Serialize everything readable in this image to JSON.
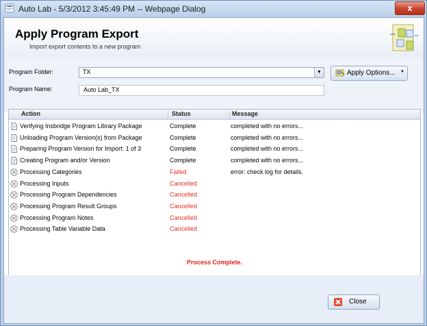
{
  "window": {
    "title": "Auto Lab - 5/3/2012 3:45:49 PM -- Webpage Dialog",
    "close_glyph": "x"
  },
  "header": {
    "title": "Apply Program Export",
    "subtitle": "Import export contents to a new program",
    "icon": "export-program-icon"
  },
  "form": {
    "folder_label": "Program Folder:",
    "folder_value": "TX",
    "name_label": "Program Name:",
    "name_value": "Auto Lab_TX",
    "apply_options_label": "Apply Options..."
  },
  "table": {
    "columns": [
      "Action",
      "Status",
      "Message"
    ],
    "rows": [
      {
        "action": "Verifying Insbridge Program Library Package",
        "status": "Complete",
        "message": "completed with no errors...",
        "state": "complete"
      },
      {
        "action": "Unloading Program Version(s) from Package",
        "status": "Complete",
        "message": "completed with no errors...",
        "state": "complete"
      },
      {
        "action": "Preparing Program Version for Import: 1 of 3",
        "status": "Complete",
        "message": "completed with no errors...",
        "state": "complete"
      },
      {
        "action": "Creating Program and/or Version",
        "status": "Complete",
        "message": "completed with no errors...",
        "state": "complete"
      },
      {
        "action": "Processing Categories",
        "status": "Failed",
        "message": "error: check log for details.",
        "state": "failed"
      },
      {
        "action": "Processing Inputs",
        "status": "Cancelled",
        "message": "",
        "state": "cancelled"
      },
      {
        "action": "Processing Program Dependencies",
        "status": "Cancelled",
        "message": "",
        "state": "cancelled"
      },
      {
        "action": "Processing Program Result Groups",
        "status": "Cancelled",
        "message": "",
        "state": "cancelled"
      },
      {
        "action": "Processing Program Notes",
        "status": "Cancelled",
        "message": "",
        "state": "cancelled"
      },
      {
        "action": "Processing Table Variable Data",
        "status": "Cancelled",
        "message": "",
        "state": "cancelled"
      }
    ],
    "footer_status": "Process Complete."
  },
  "footer": {
    "close_label": "Close"
  },
  "colors": {
    "failed": "#e03020",
    "process_complete": "#e02020"
  }
}
